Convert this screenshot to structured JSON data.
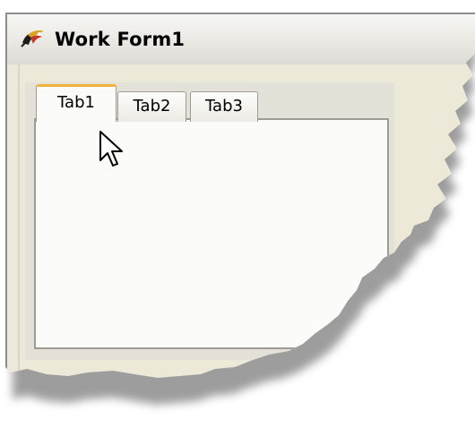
{
  "window": {
    "title": "Work Form1",
    "icon": "form-icon"
  },
  "tabs": [
    {
      "label": "Tab1",
      "active": true
    },
    {
      "label": "Tab2",
      "active": false
    },
    {
      "label": "Tab3",
      "active": false
    }
  ],
  "colors": {
    "active_tab_accent": "#f2b33a",
    "client_background": "#ece9d8",
    "tab_page_background": "#fbfbf9"
  },
  "cursor": "arrow-cursor-icon"
}
